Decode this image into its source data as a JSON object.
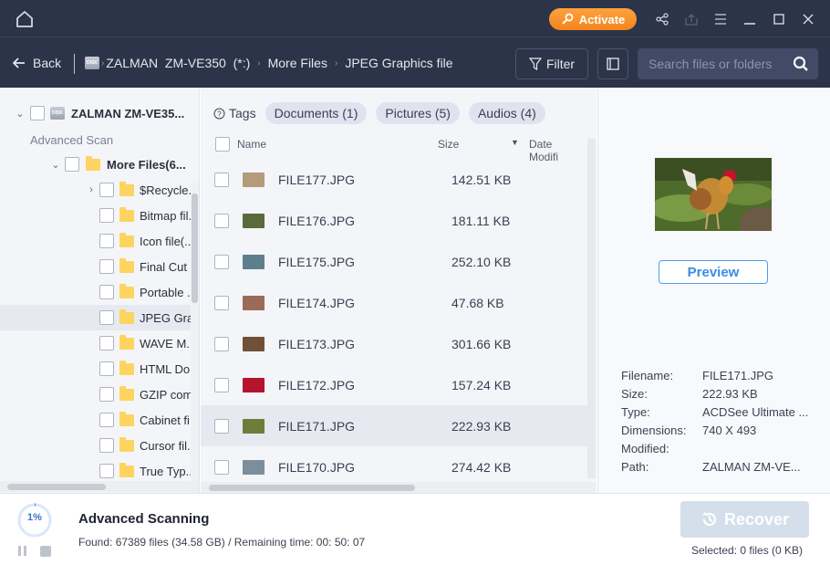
{
  "titlebar": {
    "activate_label": "Activate",
    "icons": [
      "home-icon",
      "key-icon",
      "share-icon",
      "export-icon",
      "menu-icon",
      "minimize-icon",
      "maximize-icon",
      "close-icon"
    ],
    "accent_color": "#f5841c"
  },
  "navbar": {
    "back_label": "Back",
    "breadcrumb": [
      "ZALMAN  ZM-VE350  (*:)",
      "More Files",
      "JPEG Graphics file"
    ],
    "filter_label": "Filter",
    "search_placeholder": "Search files or folders"
  },
  "tree": {
    "root_label": "ZALMAN  ZM-VE35...",
    "section_label": "Advanced Scan",
    "more_files_label": "More Files(6...",
    "folders": [
      {
        "label": "$Recycle..",
        "expandable": true
      },
      {
        "label": "Bitmap fil.."
      },
      {
        "label": "Icon file(.."
      },
      {
        "label": "Final Cut .."
      },
      {
        "label": "Portable .."
      },
      {
        "label": "JPEG Gra..",
        "selected": true
      },
      {
        "label": "WAVE M.."
      },
      {
        "label": "HTML Do"
      },
      {
        "label": "GZIP com"
      },
      {
        "label": "Cabinet fi"
      },
      {
        "label": "Cursor fil.."
      },
      {
        "label": "True Typ.."
      }
    ]
  },
  "tags": {
    "label": "Tags",
    "items": [
      "Documents (1)",
      "Pictures (5)",
      "Audios (4)"
    ]
  },
  "list": {
    "columns": {
      "name": "Name",
      "size": "Size",
      "date": "Date Modifi"
    },
    "files": [
      {
        "name": "FILE177.JPG",
        "size": "142.51 KB",
        "thumb": "#b59b7a"
      },
      {
        "name": "FILE176.JPG",
        "size": "181.11 KB",
        "thumb": "#5a6a3c"
      },
      {
        "name": "FILE175.JPG",
        "size": "252.10 KB",
        "thumb": "#5d7f8c"
      },
      {
        "name": "FILE174.JPG",
        "size": "47.68 KB",
        "thumb": "#9a6b58"
      },
      {
        "name": "FILE173.JPG",
        "size": "301.66 KB",
        "thumb": "#6e5138"
      },
      {
        "name": "FILE172.JPG",
        "size": "157.24 KB",
        "thumb": "#b5142e"
      },
      {
        "name": "FILE171.JPG",
        "size": "222.93 KB",
        "thumb": "#6f7d3c",
        "selected": true
      },
      {
        "name": "FILE170.JPG",
        "size": "274.42 KB",
        "thumb": "#7c8d9c"
      }
    ]
  },
  "preview": {
    "button_label": "Preview",
    "meta": [
      {
        "key": "Filename:",
        "value": "FILE171.JPG"
      },
      {
        "key": "Size:",
        "value": "222.93 KB"
      },
      {
        "key": "Type:",
        "value": "ACDSee Ultimate ..."
      },
      {
        "key": "Dimensions:",
        "value": "740 X 493"
      },
      {
        "key": "Modified:",
        "value": ""
      },
      {
        "key": "Path:",
        "value": "ZALMAN  ZM-VE..."
      }
    ]
  },
  "status": {
    "progress_percent": 1,
    "progress_label": "1%",
    "title": "Advanced Scanning",
    "info": "Found: 67389 files (34.58 GB) / Remaining time: 00: 50: 07",
    "recover_label": "Recover",
    "selected_info": "Selected: 0 files (0 KB)"
  }
}
